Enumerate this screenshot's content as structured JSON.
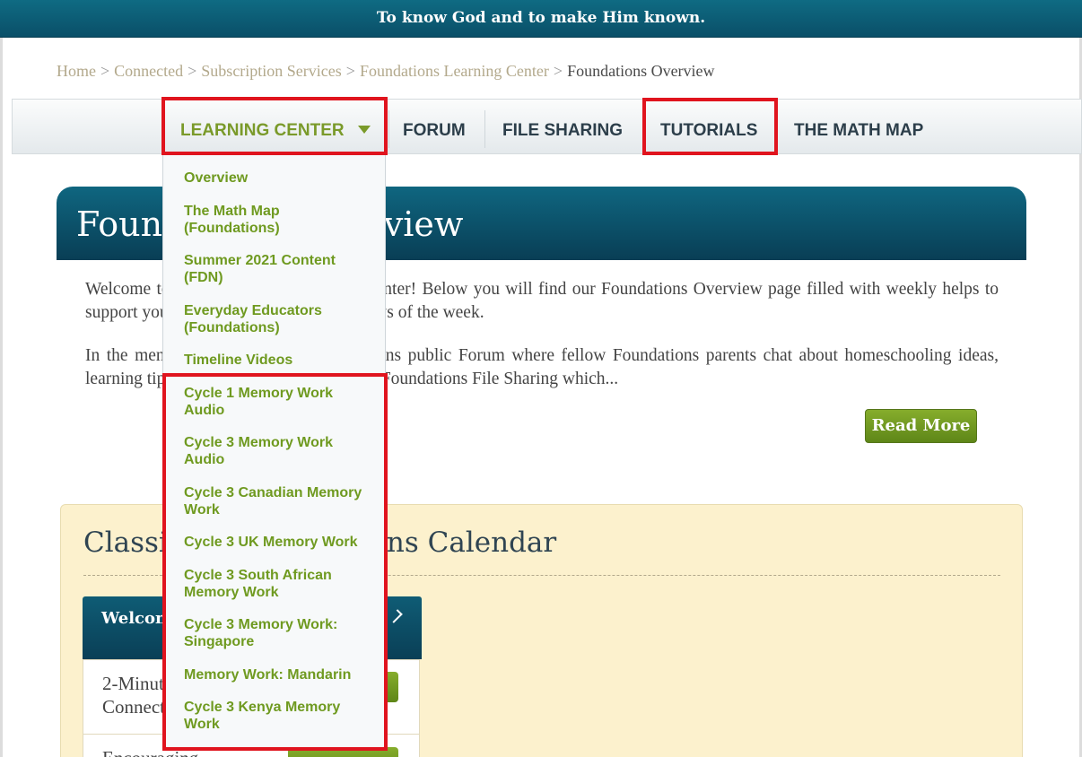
{
  "tagline": "To know God and to make Him known.",
  "breadcrumb": {
    "items": [
      "Home",
      "Connected",
      "Subscription Services",
      "Foundations Learning Center"
    ],
    "separator": ">",
    "current": "Foundations Overview"
  },
  "nav": {
    "learning_center": "LEARNING CENTER",
    "forum": "FORUM",
    "file_sharing": "FILE SHARING",
    "tutorials": "TUTORIALS",
    "math_map": "THE MATH MAP"
  },
  "dropdown": {
    "items": [
      "Overview",
      "The Math Map (Foundations)",
      "Summer 2021 Content (FDN)",
      "Everyday Educators (Foundations)",
      "Timeline Videos",
      "Cycle 1 Memory Work Audio",
      "Cycle 3 Memory Work Audio",
      "Cycle 3 Canadian Memory Work",
      "Cycle 3 UK Memory Work",
      "Cycle 3 South African Memory Work",
      "Cycle 3 Memory Work: Singapore",
      "Memory Work: Mandarin",
      "Cycle 3 Kenya Memory Work"
    ]
  },
  "hero": {
    "title": "Foundations Overview"
  },
  "intro": {
    "p1": "Welcome to the Foundations Learning Center! Below you will find our Foundations Overview page filled with weekly helps to support your learning on the other four days of the week.",
    "p2": "In the menu, you will find the Foundations public Forum where fellow Foundations parents chat about homeschooling ideas, learning tips, and more. You can also find Foundations File Sharing which..."
  },
  "read_more": "Read More",
  "calendar": {
    "title": "Classical Conversations Calendar",
    "welcome_title": "Welcome to Foundations",
    "rows": [
      "2-Minute Connection",
      "Encouraging"
    ]
  },
  "colors": {
    "accent_green": "#6f9a20",
    "header_teal": "#0a4f68",
    "highlight_red": "#e0141e"
  }
}
